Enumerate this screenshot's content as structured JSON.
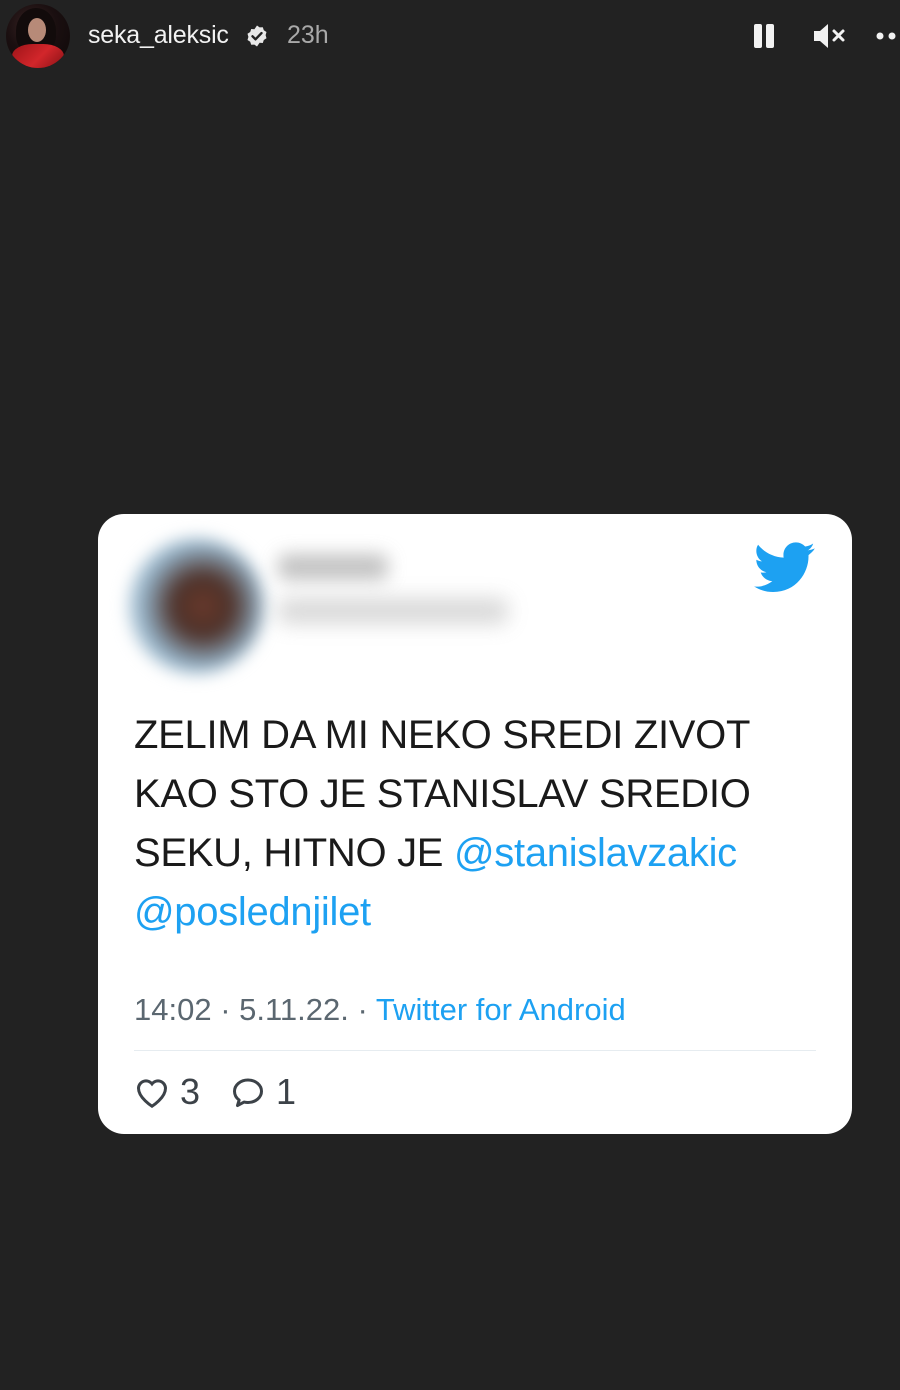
{
  "header": {
    "username": "seka_aleksic",
    "time_ago": "23h",
    "verified": true
  },
  "tweet": {
    "text_line1": "ZELIM DA MI NEKO SREDI ZIVOT",
    "text_line2": "KAO STO JE STANISLAV SREDIO",
    "text_line3_plain": "SEKU, HITNO JE ",
    "mention1": "@stanislavzakic",
    "mention2": "@poslednjilet",
    "timestamp": "14:02 · 5.11.22. · ",
    "source": "Twitter for Android",
    "likes": "3",
    "replies": "1"
  },
  "colors": {
    "background": "#222222",
    "card": "#ffffff",
    "twitter_blue": "#1da1f2",
    "text": "#1a1a1a",
    "meta": "#5b6770"
  },
  "icons": [
    "verified-icon",
    "pause-icon",
    "mute-icon",
    "more-icon",
    "twitter-bird-icon",
    "heart-icon",
    "reply-icon"
  ]
}
